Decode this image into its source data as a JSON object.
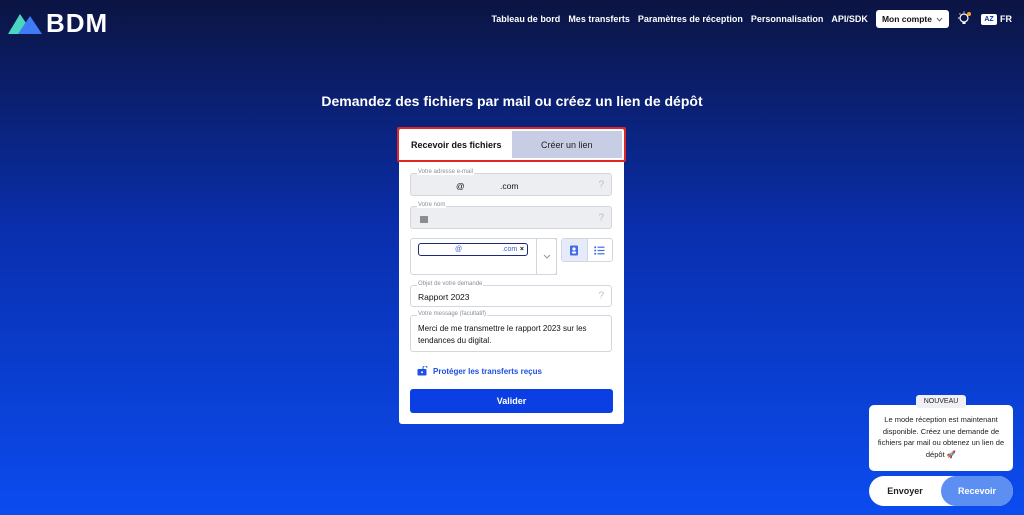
{
  "brand": {
    "name": "BDM"
  },
  "nav": {
    "items": [
      "Tableau de bord",
      "Mes transferts",
      "Paramètres de réception",
      "Personnalisation",
      "API/SDK"
    ],
    "account_label": "Mon compte",
    "lang_icon": "AZ",
    "lang": "FR"
  },
  "main": {
    "headline": "Demandez des fichiers par mail ou créez un lien de dépôt",
    "tabs": {
      "receive": "Recevoir des fichiers",
      "link": "Créer un lien"
    },
    "email": {
      "label": "Votre adresse e-mail",
      "value_at": "@",
      "value_domain": ".com",
      "help": "?"
    },
    "name": {
      "label": "Votre nom",
      "help": "?"
    },
    "recipient": {
      "value_at": "@",
      "value_domain": ".com",
      "remove": "×"
    },
    "subject": {
      "label": "Objet de votre demande",
      "value": "Rapport 2023",
      "help": "?"
    },
    "message": {
      "label": "Votre message (facultatif)",
      "value": "Merci de me transmettre le rapport 2023 sur les tendances du digital."
    },
    "protect_label": "Protéger les transferts reçus",
    "submit_label": "Valider"
  },
  "notification": {
    "badge": "NOUVEAU",
    "text": "Le mode réception est maintenant disponible. Créez une demande de fichiers par mail ou obtenez un lien de dépôt 🚀"
  },
  "mode_switch": {
    "send": "Envoyer",
    "receive": "Recevoir"
  },
  "colors": {
    "accent": "#0b3fe3",
    "highlight": "#e02727"
  }
}
